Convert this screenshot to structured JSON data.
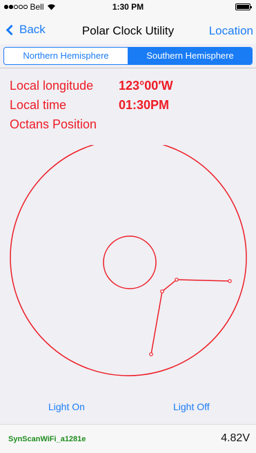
{
  "status_bar": {
    "carrier": "Bell",
    "time": "1:30 PM",
    "signal_bars": 2,
    "battery_level": 1.0,
    "icons": [
      "signal-dots-icon",
      "wifi-icon",
      "battery-icon"
    ]
  },
  "nav": {
    "back_label": "Back",
    "title": "Polar Clock Utility",
    "location_label": "Location"
  },
  "hemisphere": {
    "options": [
      "Northern Hemisphere",
      "Southern Hemisphere"
    ],
    "selected": "Southern Hemisphere"
  },
  "info": {
    "longitude_label": "Local longitude",
    "longitude_value": "123°00′W",
    "time_label": "Local time",
    "time_value": "01:30PM",
    "octans_label": "Octans Position"
  },
  "controls": {
    "light_on": "Light On",
    "light_off": "Light Off"
  },
  "footer": {
    "wifi_name": "SynScanWiFi_a1281e",
    "voltage": "4.82V"
  },
  "colors": {
    "accent": "#1a7cf5",
    "clock_red": "#ef1b24",
    "wifi_green": "#1e8c1e"
  }
}
